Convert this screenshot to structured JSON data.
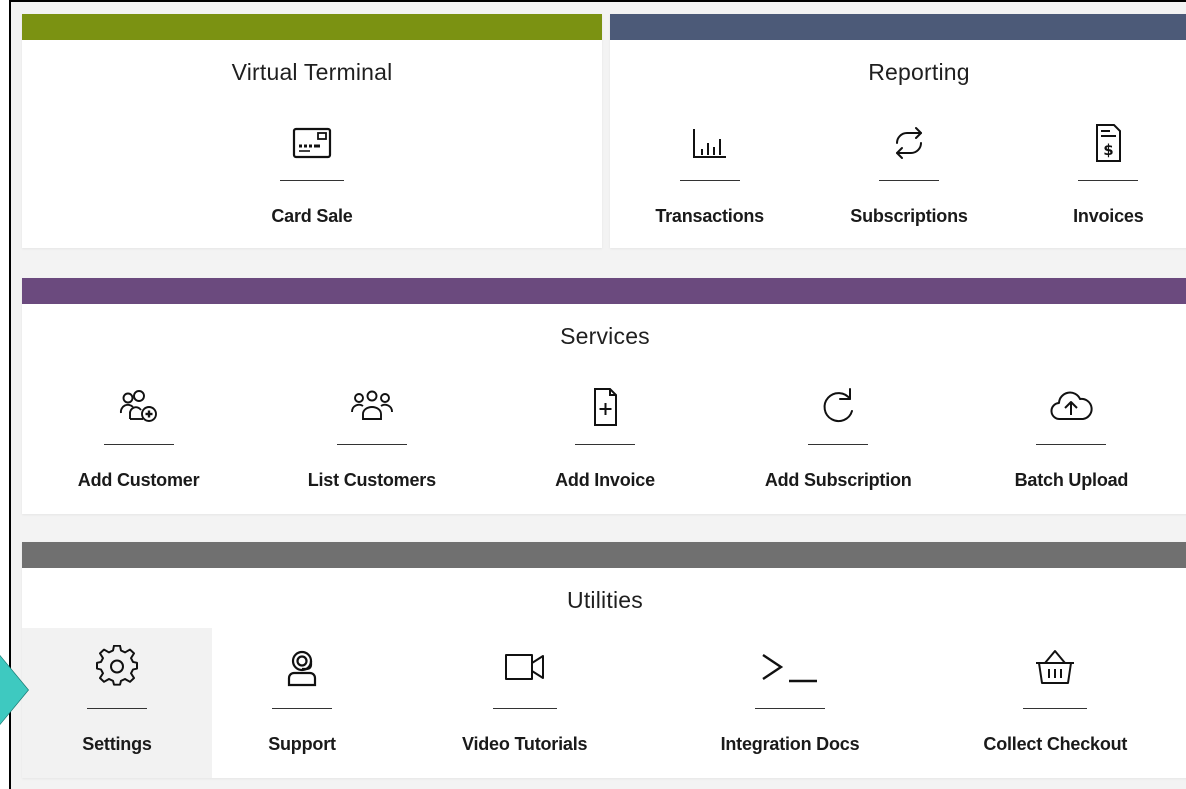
{
  "colors": {
    "virtual_terminal_bar": "#7b9212",
    "reporting_bar": "#4c5a78",
    "services_bar": "#6b4a7e",
    "utilities_bar": "#707070",
    "pointer": "#3ec9c0"
  },
  "virtual_terminal": {
    "title": "Virtual Terminal",
    "items": [
      {
        "label": "Card Sale",
        "icon": "card-terminal-icon"
      }
    ]
  },
  "reporting": {
    "title": "Reporting",
    "items": [
      {
        "label": "Transactions",
        "icon": "bar-chart-icon"
      },
      {
        "label": "Subscriptions",
        "icon": "repeat-icon"
      },
      {
        "label": "Invoices",
        "icon": "invoice-dollar-icon"
      }
    ]
  },
  "services": {
    "title": "Services",
    "items": [
      {
        "label": "Add Customer",
        "icon": "add-customer-icon"
      },
      {
        "label": "List Customers",
        "icon": "customers-group-icon"
      },
      {
        "label": "Add Invoice",
        "icon": "add-document-icon"
      },
      {
        "label": "Add Subscription",
        "icon": "refresh-icon"
      },
      {
        "label": "Batch Upload",
        "icon": "cloud-upload-icon"
      }
    ]
  },
  "utilities": {
    "title": "Utilities",
    "items": [
      {
        "label": "Settings",
        "icon": "gear-icon"
      },
      {
        "label": "Support",
        "icon": "support-agent-icon"
      },
      {
        "label": "Video Tutorials",
        "icon": "video-camera-icon"
      },
      {
        "label": "Integration Docs",
        "icon": "terminal-prompt-icon"
      },
      {
        "label": "Collect Checkout",
        "icon": "basket-icon"
      }
    ]
  }
}
